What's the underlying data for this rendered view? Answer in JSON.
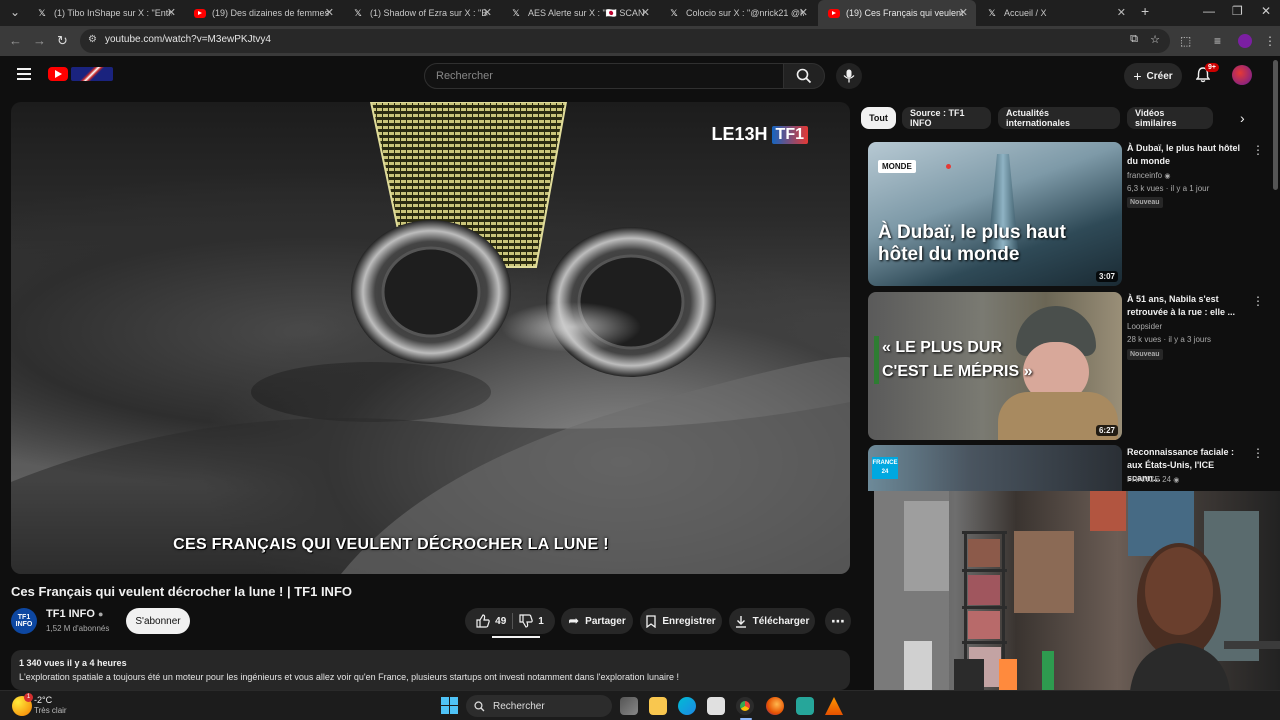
{
  "browser": {
    "tabs": [
      {
        "title": "(1) Tibo InShape sur X : \"Entraîn",
        "icon": "x-icon"
      },
      {
        "title": "(19) Des dizaines de femmes vo",
        "icon": "youtube-icon"
      },
      {
        "title": "(1) Shadow of Ezra sur X : \"Bara",
        "icon": "x-icon"
      },
      {
        "title": "AES Alerte sur X : \"🇯🇵 SCAN",
        "icon": "x-icon"
      },
      {
        "title": "Colocio sur X : \"@nrick21 @Ma",
        "icon": "x-icon"
      },
      {
        "title": "(19) Ces Français qui veulent dé",
        "icon": "youtube-icon",
        "active": true
      },
      {
        "title": "Accueil / X",
        "icon": "x-icon"
      }
    ],
    "new_tab": "+",
    "url": "youtube.com/watch?v=M3ewPKJtvy4"
  },
  "youtube": {
    "search_placeholder": "Rechercher",
    "create_label": "Créer",
    "notif_count": "9+",
    "video": {
      "caption": "CES FRANÇAIS QUI VEULENT DÉCROCHER LA LUNE !",
      "brand_le13h": "LE13H",
      "brand_tf1": "TF1",
      "title": "Ces Français qui veulent décrocher la lune ! | TF1 INFO",
      "channel": "TF1 INFO",
      "channel_avatar": "TF1 INFO",
      "subscribers": "1,52 M d'abonnés",
      "subscribe_label": "S'abonner",
      "likes": "49",
      "dislikes": "1",
      "share_label": "Partager",
      "save_label": "Enregistrer",
      "download_label": "Télécharger",
      "views_meta": "1 340 vues  il y a 4 heures",
      "description": "L'exploration spatiale a toujours été un moteur pour les ingénieurs et vous allez voir qu'en France, plusieurs startups ont investi notamment dans l'exploration lunaire !"
    },
    "chips": [
      "Tout",
      "Source : TF1 INFO",
      "Actualités internationales",
      "Vidéos similaires"
    ],
    "related": [
      {
        "title": "À Dubaï, le plus haut hôtel du monde",
        "channel": "franceinfo",
        "meta": "6,3 k vues · il y a 1 jour",
        "badge": "Nouveau",
        "duration": "3:07",
        "thumb_text": "À Dubaï, le plus haut hôtel du monde",
        "thumb_tag": "MONDE"
      },
      {
        "title": "À 51 ans, Nabila s'est retrouvée à la rue : elle ...",
        "channel": "Loopsider",
        "meta": "28 k vues · il y a 3 jours",
        "badge": "Nouveau",
        "duration": "6:27",
        "thumb_text_1": "« LE PLUS DUR",
        "thumb_text_2": "C'EST LE MÉPRIS »"
      },
      {
        "title": "Reconnaissance faciale : aux États-Unis, l'ICE scann...",
        "channel": "FRANCE 24",
        "thumb_tag": "FRANCE 24"
      }
    ]
  },
  "taskbar": {
    "weather_temp": "-2°C",
    "weather_desc": "Très clair",
    "weather_badge": "1",
    "search_label": "Rechercher"
  }
}
